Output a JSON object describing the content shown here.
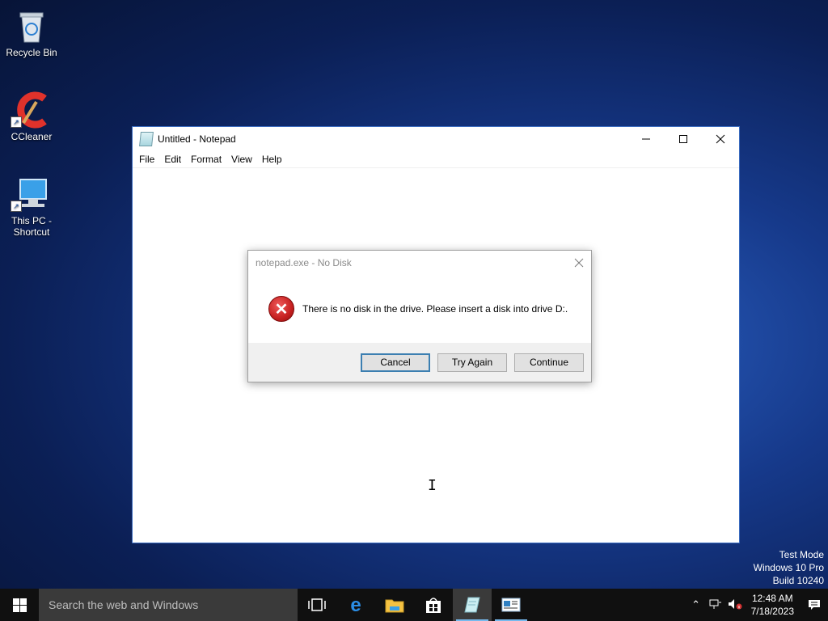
{
  "desktop": {
    "icons": [
      {
        "label": "Recycle Bin"
      },
      {
        "label": "CCleaner"
      },
      {
        "label": "This PC - Shortcut"
      }
    ]
  },
  "notepad": {
    "title": "Untitled - Notepad",
    "menu": [
      "File",
      "Edit",
      "Format",
      "View",
      "Help"
    ]
  },
  "dialog": {
    "title": "notepad.exe - No Disk",
    "message": "There is no disk in the drive. Please insert a disk into drive D:.",
    "buttons": {
      "cancel": "Cancel",
      "try_again": "Try Again",
      "continue": "Continue"
    }
  },
  "watermark": {
    "line1": "Test Mode",
    "line2": "Windows 10 Pro",
    "line3": "Build 10240"
  },
  "taskbar": {
    "search_placeholder": "Search the web and Windows",
    "clock": {
      "time": "12:48 AM",
      "date": "7/18/2023"
    }
  },
  "colors": {
    "desktop_blue": "#16398a",
    "taskbar": "#101010",
    "accent": "#76b9ed",
    "error_red": "#c62020"
  }
}
